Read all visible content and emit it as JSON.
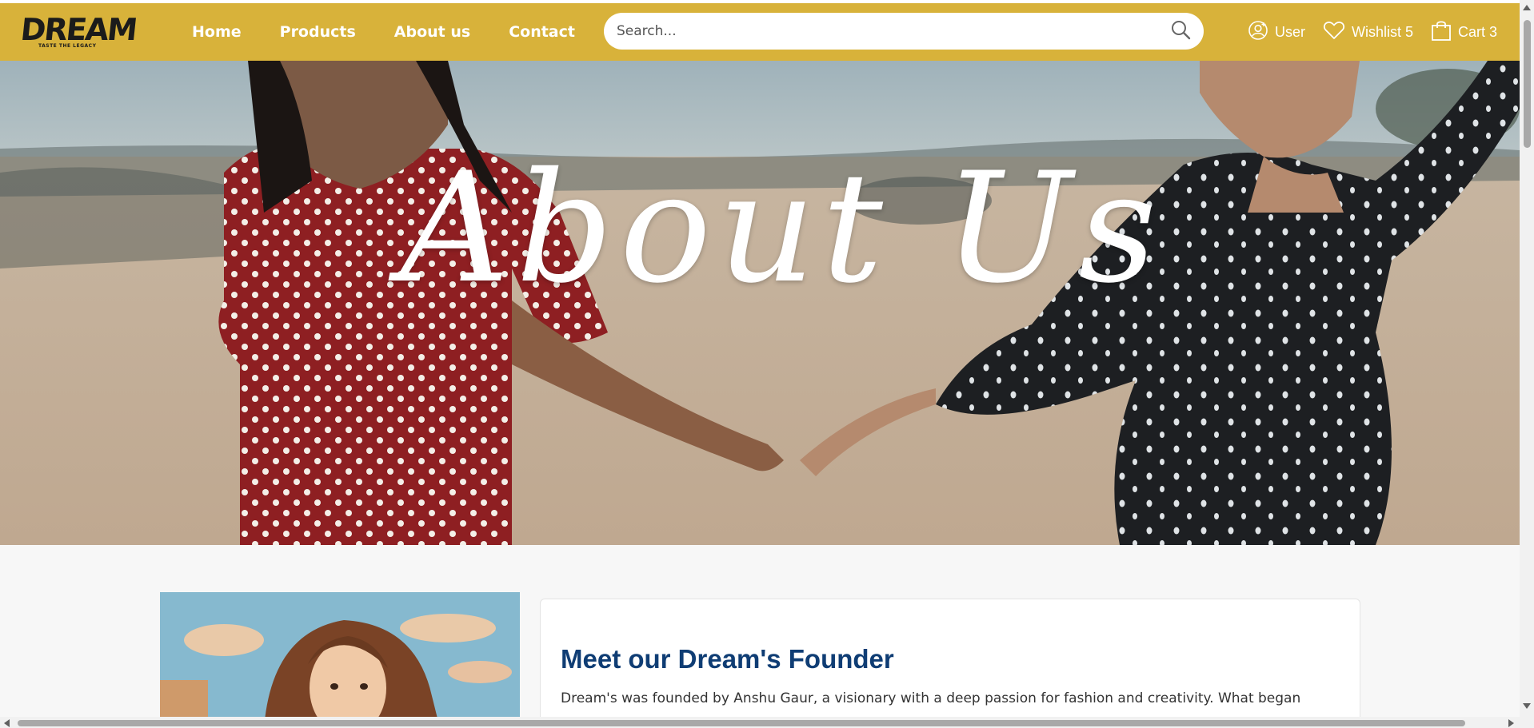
{
  "brand": {
    "logo_text": "DREAM",
    "tagline": "TASTE THE LEGACY",
    "nav_color": "#d8b23a"
  },
  "nav": {
    "links": [
      {
        "label": "Home"
      },
      {
        "label": "Products"
      },
      {
        "label": "About us"
      },
      {
        "label": "Contact"
      }
    ],
    "search_placeholder": "Search...",
    "user_label": "User",
    "wishlist_label": "Wishlist 5",
    "cart_label": "Cart 3"
  },
  "hero": {
    "title": "About Us"
  },
  "founder": {
    "heading": "Meet our Dream's Founder",
    "text": "Dream's was founded by Anshu Gaur, a visionary with a deep passion for fashion and creativity. What began"
  },
  "colors": {
    "heading": "#0f3d74",
    "text": "#333333"
  }
}
